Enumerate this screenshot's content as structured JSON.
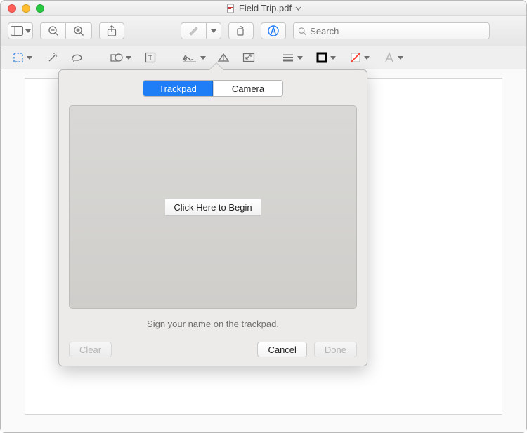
{
  "window": {
    "title": "Field Trip.pdf"
  },
  "search": {
    "placeholder": "Search"
  },
  "popover": {
    "tabs": {
      "trackpad": "Trackpad",
      "camera": "Camera"
    },
    "begin_label": "Click Here to Begin",
    "instruction": "Sign your name on the trackpad.",
    "buttons": {
      "clear": "Clear",
      "cancel": "Cancel",
      "done": "Done"
    }
  }
}
